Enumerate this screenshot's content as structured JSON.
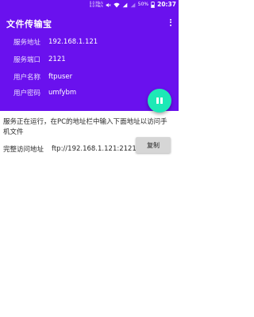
{
  "status_bar": {
    "net_up": "0.0 Mb/s",
    "net_down": "0.0 Mb/s",
    "battery": "50%",
    "time": "20:37"
  },
  "header": {
    "title": "文件传输宝",
    "color": "#6a11ee"
  },
  "info": {
    "address_label": "服务地址",
    "address_value": "192.168.1.121",
    "port_label": "服务端口",
    "port_value": "2121",
    "user_label": "用户名称",
    "user_value": "ftpuser",
    "password_label": "用户密码",
    "password_value": "umfybm"
  },
  "fab": {
    "icon": "pause-icon",
    "color": "#1de9b6"
  },
  "content": {
    "message": "服务正在运行，在PC的地址栏中输入下面地址以访问手机文件",
    "access_label": "完整访问地址",
    "access_url": "ftp://192.168.1.121:2121",
    "copy_label": "复制"
  }
}
